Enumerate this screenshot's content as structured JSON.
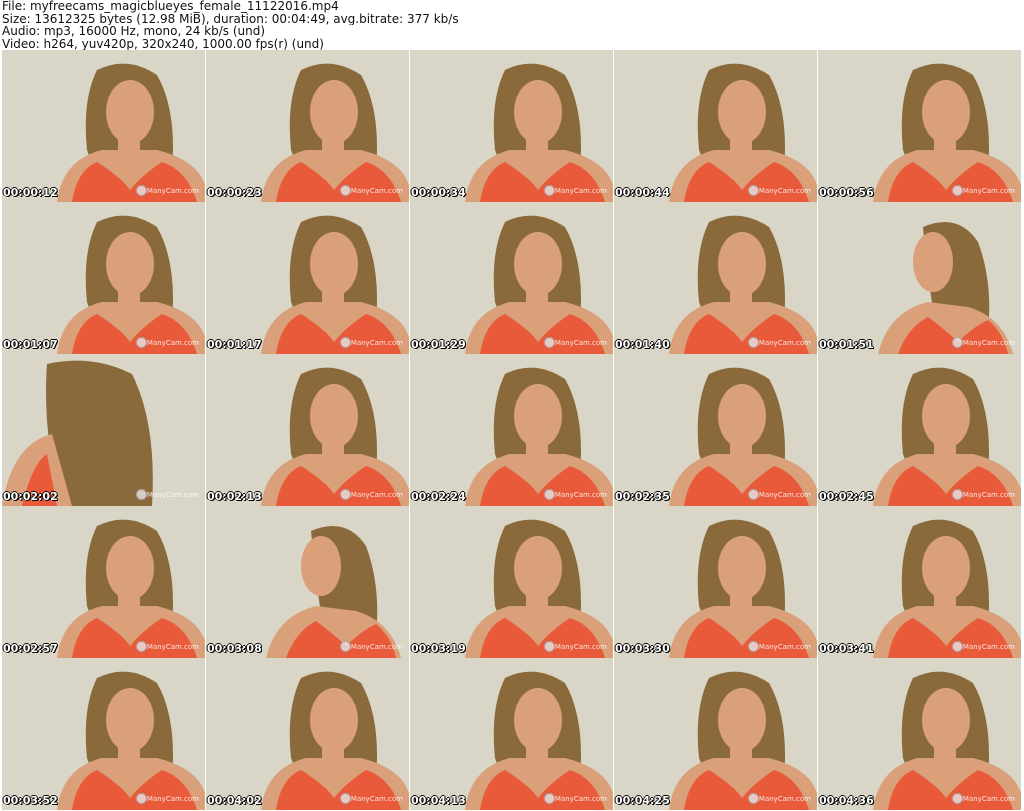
{
  "header": {
    "file_line": "File: myfreecams_magicblueyes_female_11122016.mp4",
    "size_line": "Size: 13612325 bytes (12.98 MiB), duration: 00:04:49, avg.bitrate: 377 kb/s",
    "audio_line": "Audio: mp3, 16000 Hz, mono, 24 kb/s (und)",
    "video_line": "Video: h264, yuv420p, 320x240, 1000.00 fps(r) (und)"
  },
  "thumbnails": [
    {
      "time": "00:00:12",
      "pose": "front"
    },
    {
      "time": "00:00:23",
      "pose": "front"
    },
    {
      "time": "00:00:34",
      "pose": "front"
    },
    {
      "time": "00:00:44",
      "pose": "front"
    },
    {
      "time": "00:00:56",
      "pose": "front"
    },
    {
      "time": "00:01:07",
      "pose": "front"
    },
    {
      "time": "00:01:17",
      "pose": "front"
    },
    {
      "time": "00:01:29",
      "pose": "front"
    },
    {
      "time": "00:01:40",
      "pose": "front"
    },
    {
      "time": "00:01:51",
      "pose": "side"
    },
    {
      "time": "00:02:02",
      "pose": "back"
    },
    {
      "time": "00:02:13",
      "pose": "front"
    },
    {
      "time": "00:02:24",
      "pose": "front"
    },
    {
      "time": "00:02:35",
      "pose": "front"
    },
    {
      "time": "00:02:45",
      "pose": "front"
    },
    {
      "time": "00:02:57",
      "pose": "front"
    },
    {
      "time": "00:03:08",
      "pose": "side"
    },
    {
      "time": "00:03:19",
      "pose": "front"
    },
    {
      "time": "00:03:30",
      "pose": "front"
    },
    {
      "time": "00:03:41",
      "pose": "front"
    },
    {
      "time": "00:03:52",
      "pose": "front"
    },
    {
      "time": "00:04:02",
      "pose": "front"
    },
    {
      "time": "00:04:13",
      "pose": "front"
    },
    {
      "time": "00:04:25",
      "pose": "front"
    },
    {
      "time": "00:04:36",
      "pose": "front"
    }
  ],
  "watermark": "ManyCam.com",
  "colors": {
    "background_wall": "#d9d6c8",
    "top": "#e85a3a",
    "hair": "#8a6a3a",
    "skin": "#d9a07a"
  }
}
